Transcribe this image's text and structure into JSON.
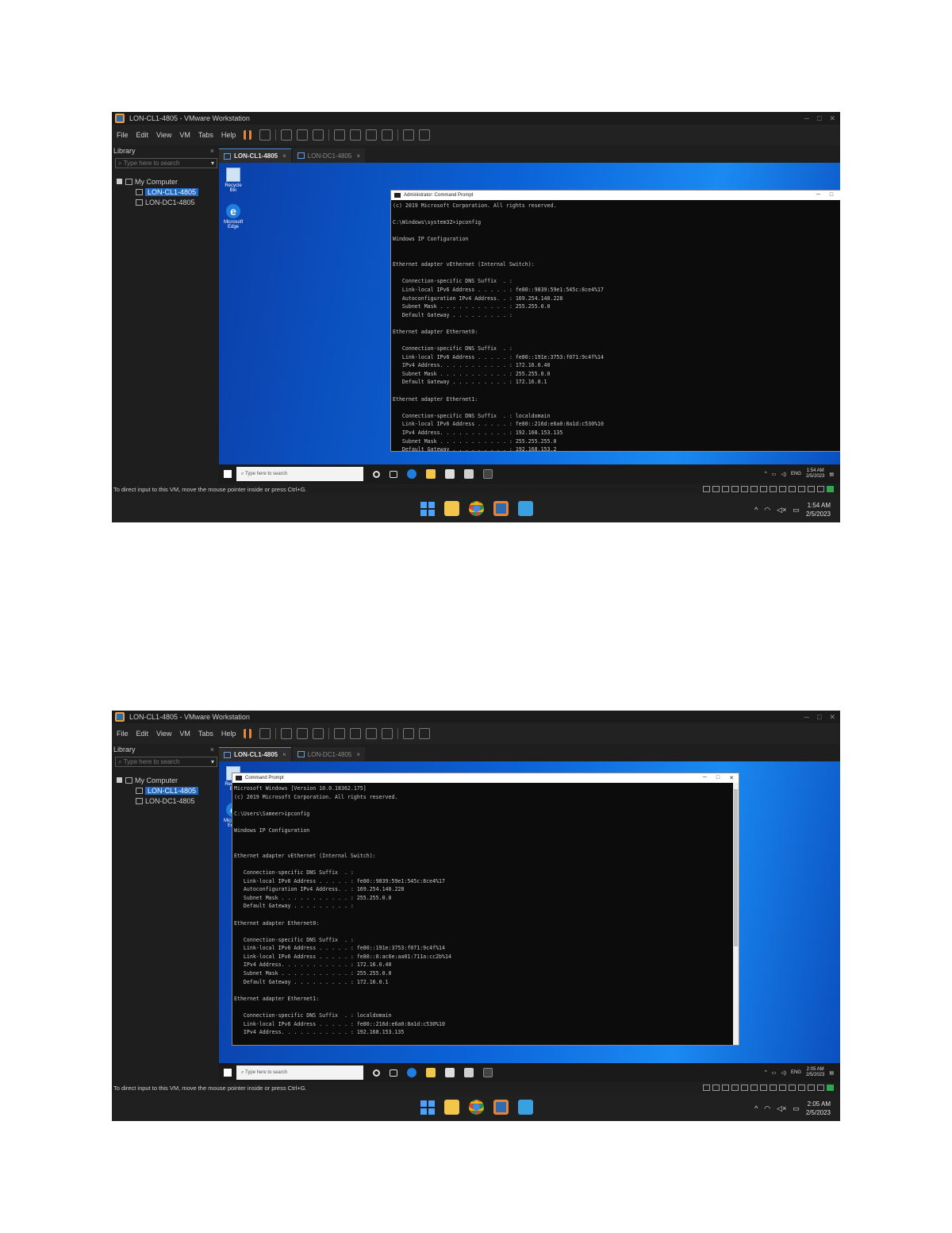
{
  "screenshots": [
    {
      "window_title": "LON-CL1-4805 - VMware Workstation",
      "menu": [
        "File",
        "Edit",
        "View",
        "VM",
        "Tabs",
        "Help"
      ],
      "library": {
        "title": "Library",
        "close": "×",
        "search_placeholder": "Type here to search",
        "tree_root": "My Computer",
        "vms": [
          "LON-CL1-4805",
          "LON-DC1-4805"
        ],
        "selected_index": 0
      },
      "tabs": [
        {
          "label": "LON-CL1-4805",
          "close": "×",
          "active": true
        },
        {
          "label": "LON-DC1-4805",
          "close": "×",
          "active": false
        }
      ],
      "desktop_icons": [
        "Recycle Bin",
        "Microsoft Edge"
      ],
      "cmd": {
        "title": "Administrator: Command Prompt",
        "lines": [
          "(c) 2019 Microsoft Corporation. All rights reserved.",
          "",
          "C:\\Windows\\system32>ipconfig",
          "",
          "Windows IP Configuration",
          "",
          "",
          "Ethernet adapter vEthernet (Internal Switch):",
          "",
          "   Connection-specific DNS Suffix  . :",
          "   Link-local IPv6 Address . . . . . : fe80::9839:59e1:545c:8ce4%17",
          "   Autoconfiguration IPv4 Address. . : 169.254.140.228",
          "   Subnet Mask . . . . . . . . . . . : 255.255.0.0",
          "   Default Gateway . . . . . . . . . :",
          "",
          "Ethernet adapter Ethernet0:",
          "",
          "   Connection-specific DNS Suffix  . :",
          "   Link-local IPv6 Address . . . . . : fe80::191e:3753:f071:9c4f%14",
          "   IPv4 Address. . . . . . . . . . . : 172.16.0.40",
          "   Subnet Mask . . . . . . . . . . . : 255.255.0.0",
          "   Default Gateway . . . . . . . . . : 172.16.0.1",
          "",
          "Ethernet adapter Ethernet1:",
          "",
          "   Connection-specific DNS Suffix  . : localdomain",
          "   Link-local IPv6 Address . . . . . : fe80::216d:e6a0:8a1d:c530%10",
          "   IPv4 Address. . . . . . . . . . . : 192.168.153.135",
          "   Subnet Mask . . . . . . . . . . . : 255.255.255.0",
          "   Default Gateway . . . . . . . . . : 192.168.153.2"
        ]
      },
      "guest_taskbar": {
        "search_placeholder": "Type here to search",
        "lang": "ENG",
        "time": "1:54 AM",
        "date": "2/5/2023"
      },
      "status_text": "To direct input to this VM, move the mouse pointer inside or press Ctrl+G.",
      "host_clock": {
        "time": "1:54 AM",
        "date": "2/5/2023"
      }
    },
    {
      "window_title": "LON-CL1-4805 - VMware Workstation",
      "menu": [
        "File",
        "Edit",
        "View",
        "VM",
        "Tabs",
        "Help"
      ],
      "library": {
        "title": "Library",
        "close": "×",
        "search_placeholder": "Type here to search",
        "tree_root": "My Computer",
        "vms": [
          "LON-CL1-4805",
          "LON-DC1-4805"
        ],
        "selected_index": 0
      },
      "tabs": [
        {
          "label": "LON-CL1-4805",
          "close": "×",
          "active": true
        },
        {
          "label": "LON-DC1-4805",
          "close": "×",
          "active": false
        }
      ],
      "desktop_icons": [
        "Recycle Bin",
        "Microsoft Edge"
      ],
      "cmd": {
        "title": "Command Prompt",
        "lines": [
          "Microsoft Windows [Version 10.0.18362.175]",
          "(c) 2019 Microsoft Corporation. All rights reserved.",
          "",
          "C:\\Users\\Sameer>ipconfig",
          "",
          "Windows IP Configuration",
          "",
          "",
          "Ethernet adapter vEthernet (Internal Switch):",
          "",
          "   Connection-specific DNS Suffix  . :",
          "   Link-local IPv6 Address . . . . . : fe80::9839:59e1:545c:8ce4%17",
          "   Autoconfiguration IPv4 Address. . : 169.254.140.228",
          "   Subnet Mask . . . . . . . . . . . : 255.255.0.0",
          "   Default Gateway . . . . . . . . . :",
          "",
          "Ethernet adapter Ethernet0:",
          "",
          "   Connection-specific DNS Suffix  . :",
          "   Link-local IPv6 Address . . . . . : fe80::191e:3753:f071:9c4f%14",
          "   Link-local IPv6 Address . . . . . : fe80::8:ac6e:aa01:711a:cc2b%14",
          "   IPv4 Address. . . . . . . . . . . : 172.16.0.40",
          "   Subnet Mask . . . . . . . . . . . : 255.255.0.0",
          "   Default Gateway . . . . . . . . . : 172.16.0.1",
          "",
          "Ethernet adapter Ethernet1:",
          "",
          "   Connection-specific DNS Suffix  . : localdomain",
          "   Link-local IPv6 Address . . . . . : fe80::216d:e6a0:8a1d:c530%10",
          "   IPv4 Address. . . . . . . . . . . : 192.168.153.135"
        ]
      },
      "guest_taskbar": {
        "search_placeholder": "Type here to search",
        "lang": "ENG",
        "time": "2:05 AM",
        "date": "2/5/2023"
      },
      "status_text": "To direct input to this VM, move the mouse pointer inside or press Ctrl+G.",
      "host_clock": {
        "time": "2:05 AM",
        "date": "2/5/2023"
      }
    }
  ]
}
